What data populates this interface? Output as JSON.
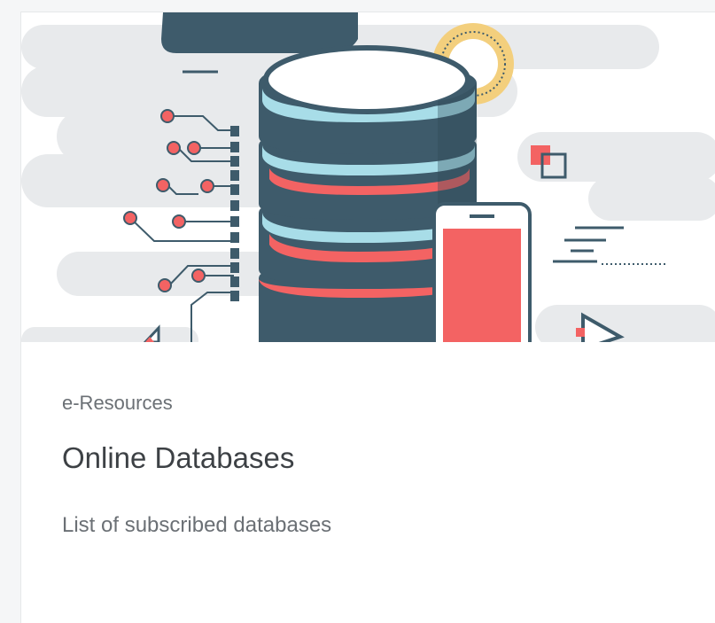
{
  "card": {
    "category": "e-Resources",
    "title": "Online Databases",
    "description": "List of subscribed databases",
    "illustration": "database-server-with-smartphone-icon",
    "colors": {
      "accent": "#f36363",
      "dark": "#3e5b6b",
      "light_blue": "#a8dde8",
      "cloud_gray": "#e8eaec",
      "gear": "#f3cf7d"
    }
  }
}
